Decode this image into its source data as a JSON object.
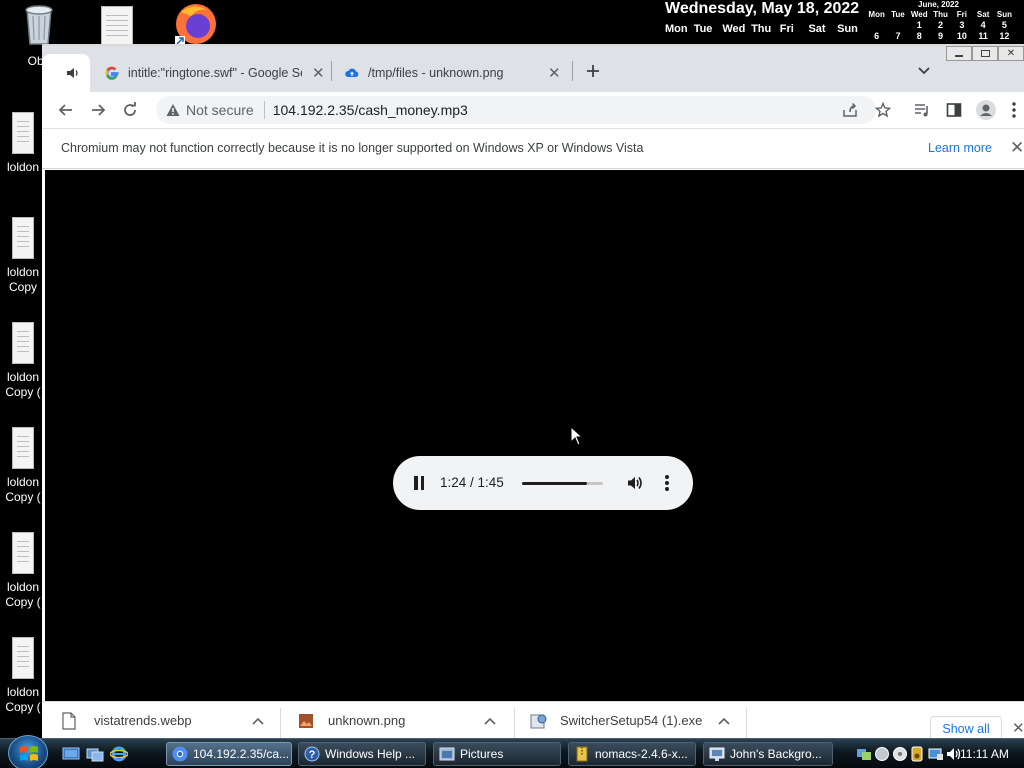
{
  "desktop": {
    "recycle_label": "Obu",
    "icons": [
      {
        "label": "loldon"
      },
      {
        "label": "loldon",
        "label2": "Copy"
      },
      {
        "label": "loldon",
        "label2": "Copy ("
      },
      {
        "label": "loldon",
        "label2": "Copy ("
      },
      {
        "label": "loldon",
        "label2": "Copy ("
      },
      {
        "label": "loldon",
        "label2": "Copy ("
      }
    ]
  },
  "date_widget": {
    "full_date": "Wednesday, May 18, 2022",
    "weekdays": [
      "Mon",
      "Tue",
      "Wed",
      "Thu",
      "Fri",
      "Sat",
      "Sun"
    ],
    "calendar_month": "June, 2022",
    "calendar_days": [
      "Mon",
      "Tue",
      "Wed",
      "Thu",
      "Fri",
      "Sat",
      "Sun"
    ],
    "calendar_rows": [
      [
        "6",
        "7",
        "8",
        "9",
        "10",
        "11",
        "12"
      ]
    ],
    "calendar_row1": [
      "",
      "",
      "1",
      "2",
      "3",
      "4",
      "5"
    ]
  },
  "browser": {
    "tabs": [
      {
        "title": "intitle:\"ringtone.swf\" - Google Se",
        "icon": "google-g-icon"
      },
      {
        "title": "/tmp/files - unknown.png",
        "icon": "cloud-upload-icon"
      }
    ],
    "security_label": "Not secure",
    "url": "104.192.2.35/cash_money.mp3",
    "infobar": {
      "message": "Chromium may not function correctly because it is no longer supported on Windows XP or Windows Vista",
      "link": "Learn more"
    },
    "player": {
      "time": "1:24 / 1:45",
      "progress_fraction": 0.8
    },
    "downloads": [
      {
        "name": "vistatrends.webp"
      },
      {
        "name": "unknown.png"
      },
      {
        "name": "SwitcherSetup54 (1).exe"
      }
    ],
    "show_all": "Show all"
  },
  "taskbar": {
    "tasks": [
      {
        "label": "104.192.2.35/ca..."
      },
      {
        "label": "Windows Help ..."
      },
      {
        "label": "Pictures"
      },
      {
        "label": "nomacs-2.4.6-x..."
      },
      {
        "label": "John's Backgro..."
      }
    ],
    "clock": "11:11 AM"
  },
  "colors": {
    "accent": "#1a73e8",
    "tabstrip": "#dee1e6",
    "omnibox": "#f1f3f4",
    "player_bg": "#f1f3f4"
  }
}
